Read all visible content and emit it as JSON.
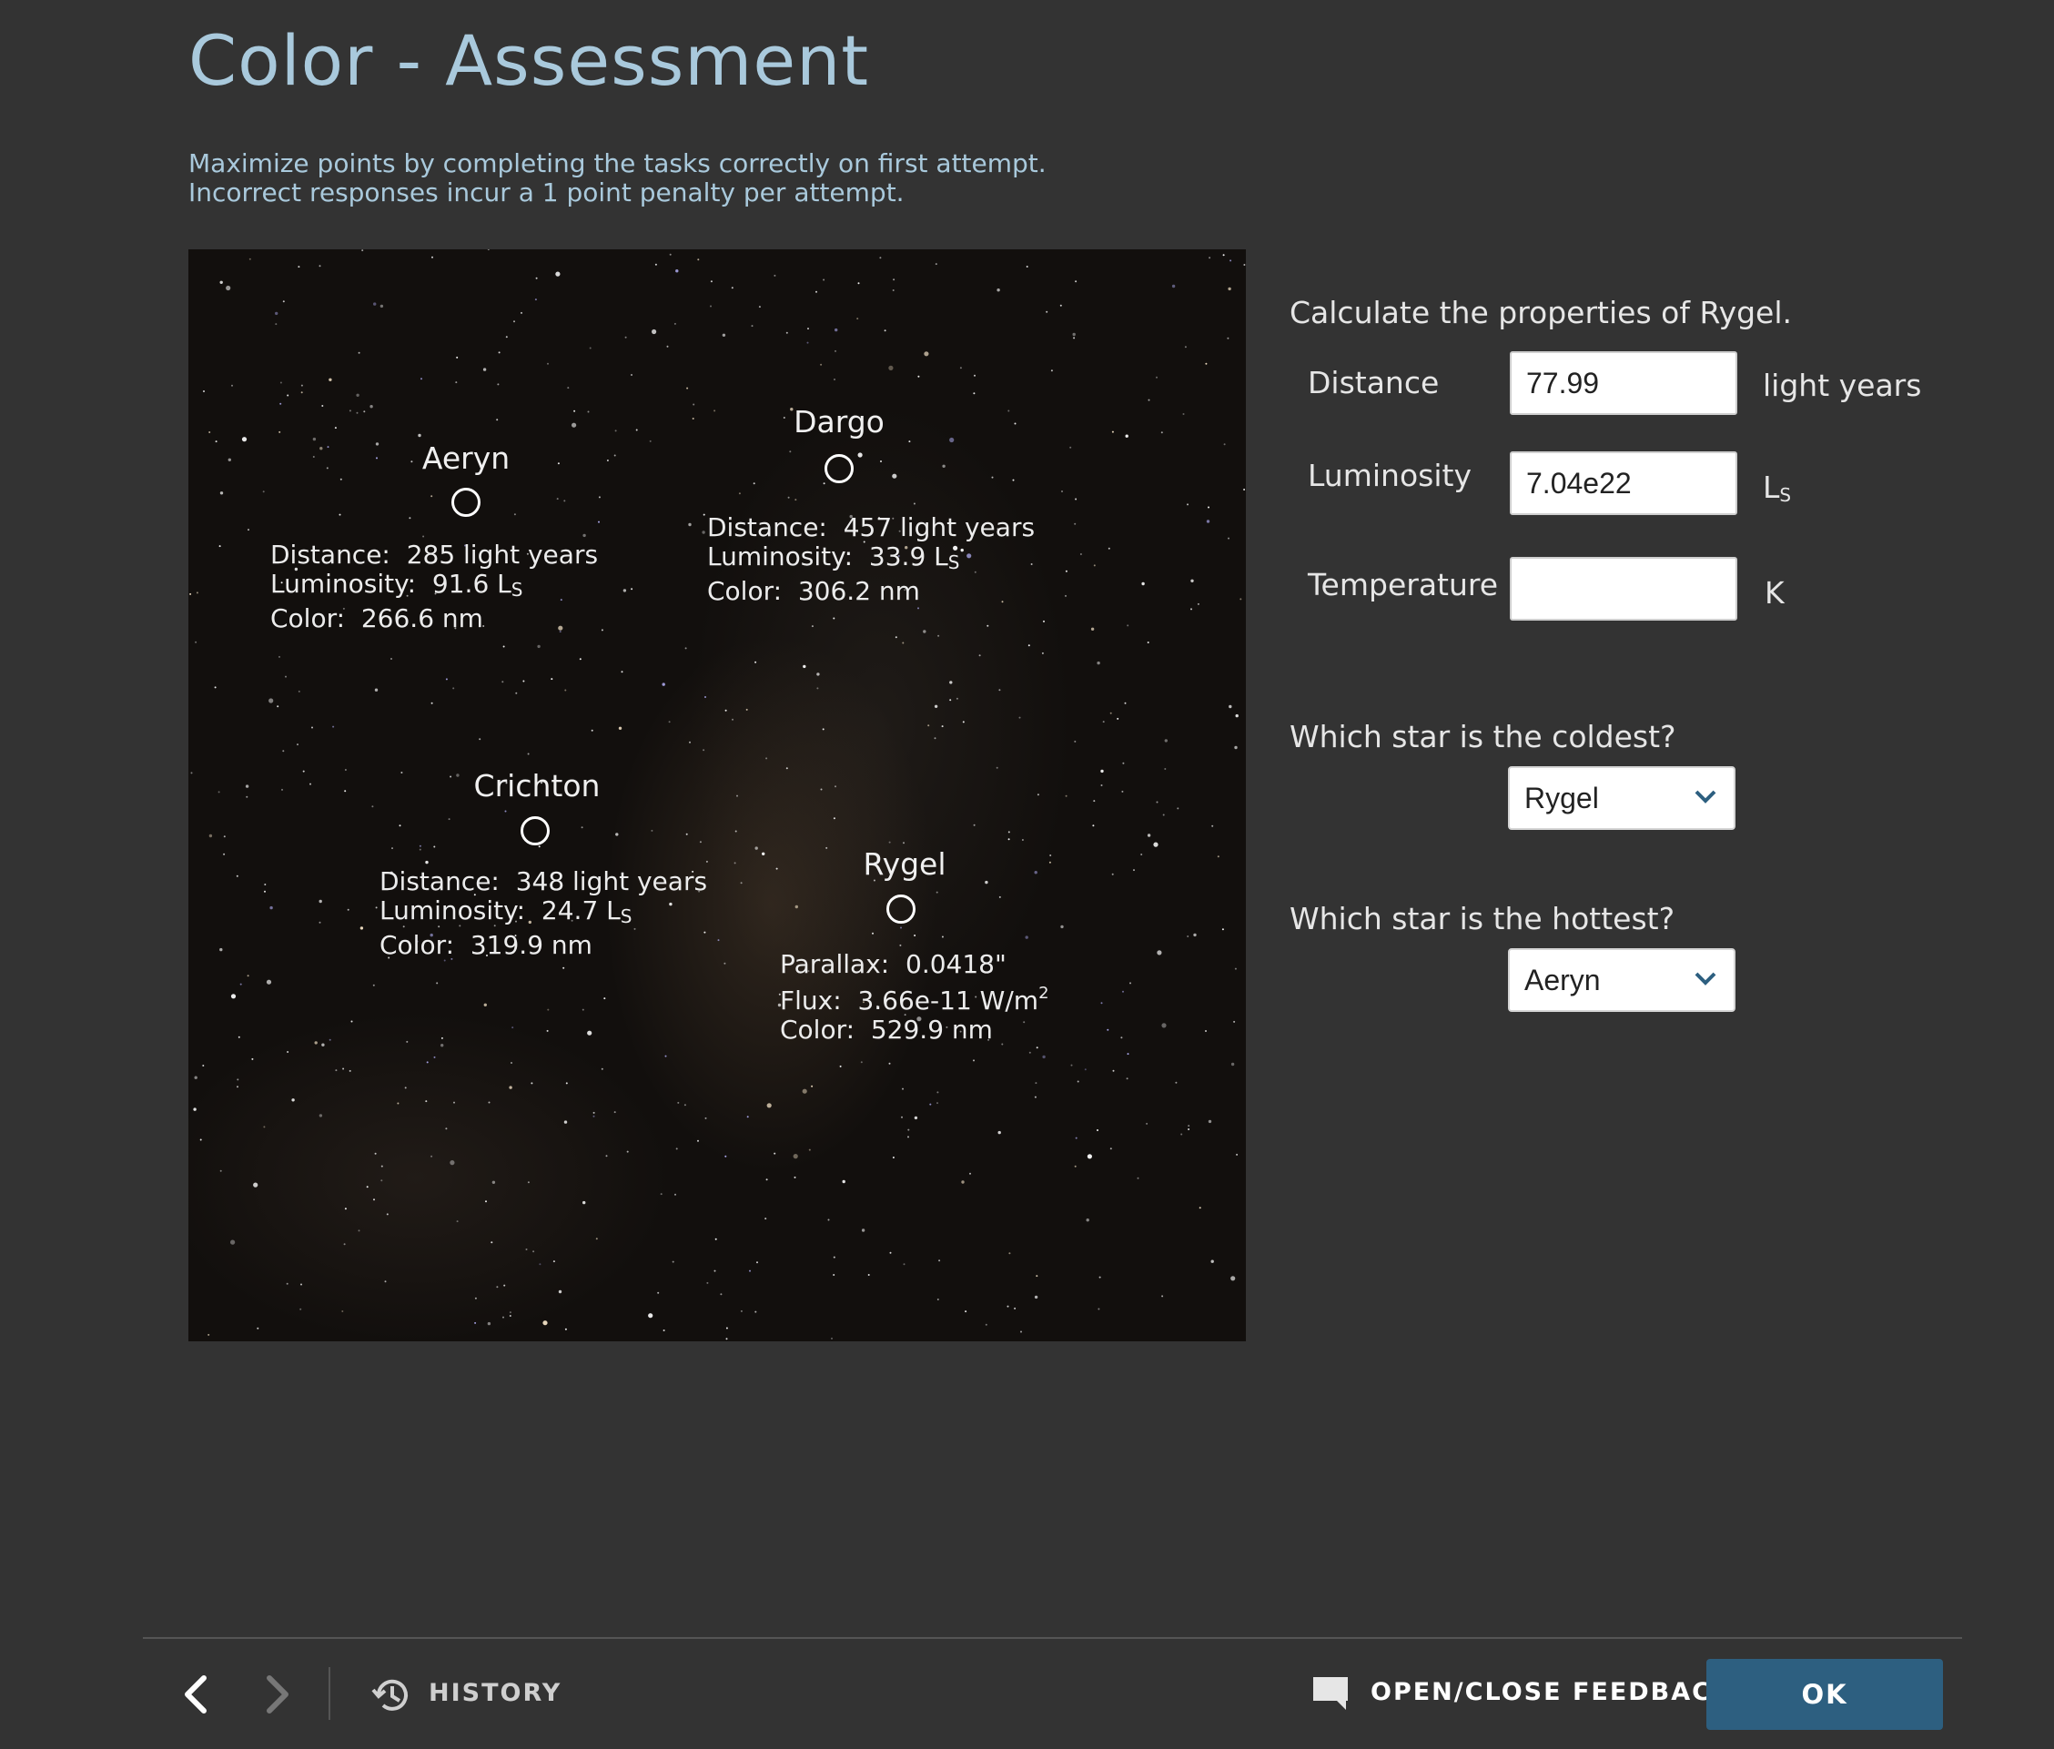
{
  "page": {
    "title": "Color - Assessment",
    "instructions": [
      "Maximize points by completing the tasks correctly on first attempt.",
      "Incorrect responses incur a 1 point penalty per attempt."
    ]
  },
  "sky_image": {
    "stars": [
      {
        "name": "Aeryn",
        "lines": [
          {
            "label": "Distance:",
            "value": "285 light years"
          },
          {
            "label": "Luminosity:",
            "value": "91.6 L",
            "sub": "S"
          },
          {
            "label": "Color:",
            "value": "266.6 nm"
          }
        ]
      },
      {
        "name": "Dargo",
        "lines": [
          {
            "label": "Distance:",
            "value": "457 light years"
          },
          {
            "label": "Luminosity:",
            "value": "33.9 L",
            "sub": "S"
          },
          {
            "label": "Color:",
            "value": "306.2 nm"
          }
        ]
      },
      {
        "name": "Crichton",
        "lines": [
          {
            "label": "Distance:",
            "value": "348 light years"
          },
          {
            "label": "Luminosity:",
            "value": "24.7 L",
            "sub": "S"
          },
          {
            "label": "Color:",
            "value": "319.9 nm"
          }
        ]
      },
      {
        "name": "Rygel",
        "lines": [
          {
            "label": "Parallax:",
            "value": "0.0418\""
          },
          {
            "label": "Flux:",
            "value": "3.66e-11 W/m",
            "sup": "2"
          },
          {
            "label": "Color:",
            "value": "529.9 nm"
          }
        ]
      }
    ]
  },
  "calc": {
    "prompt": "Calculate the properties of Rygel.",
    "fields": [
      {
        "label": "Distance",
        "value": "77.99",
        "unit": "light years"
      },
      {
        "label": "Luminosity",
        "value": "7.04e22",
        "unit": "L",
        "unit_sub": "S"
      },
      {
        "label": "Temperature",
        "value": "",
        "unit": "K"
      }
    ]
  },
  "coldest": {
    "question": "Which star is the coldest?",
    "selected": "Rygel"
  },
  "hottest": {
    "question": "Which star is the hottest?",
    "selected": "Aeryn"
  },
  "footer": {
    "history_label": "HISTORY",
    "feedback_label": "OPEN/CLOSE FEEDBACK",
    "ok_label": "OK",
    "colors": {
      "ok_button": "#2d5f80",
      "title": "#a9c9dc",
      "background": "#333333"
    }
  }
}
